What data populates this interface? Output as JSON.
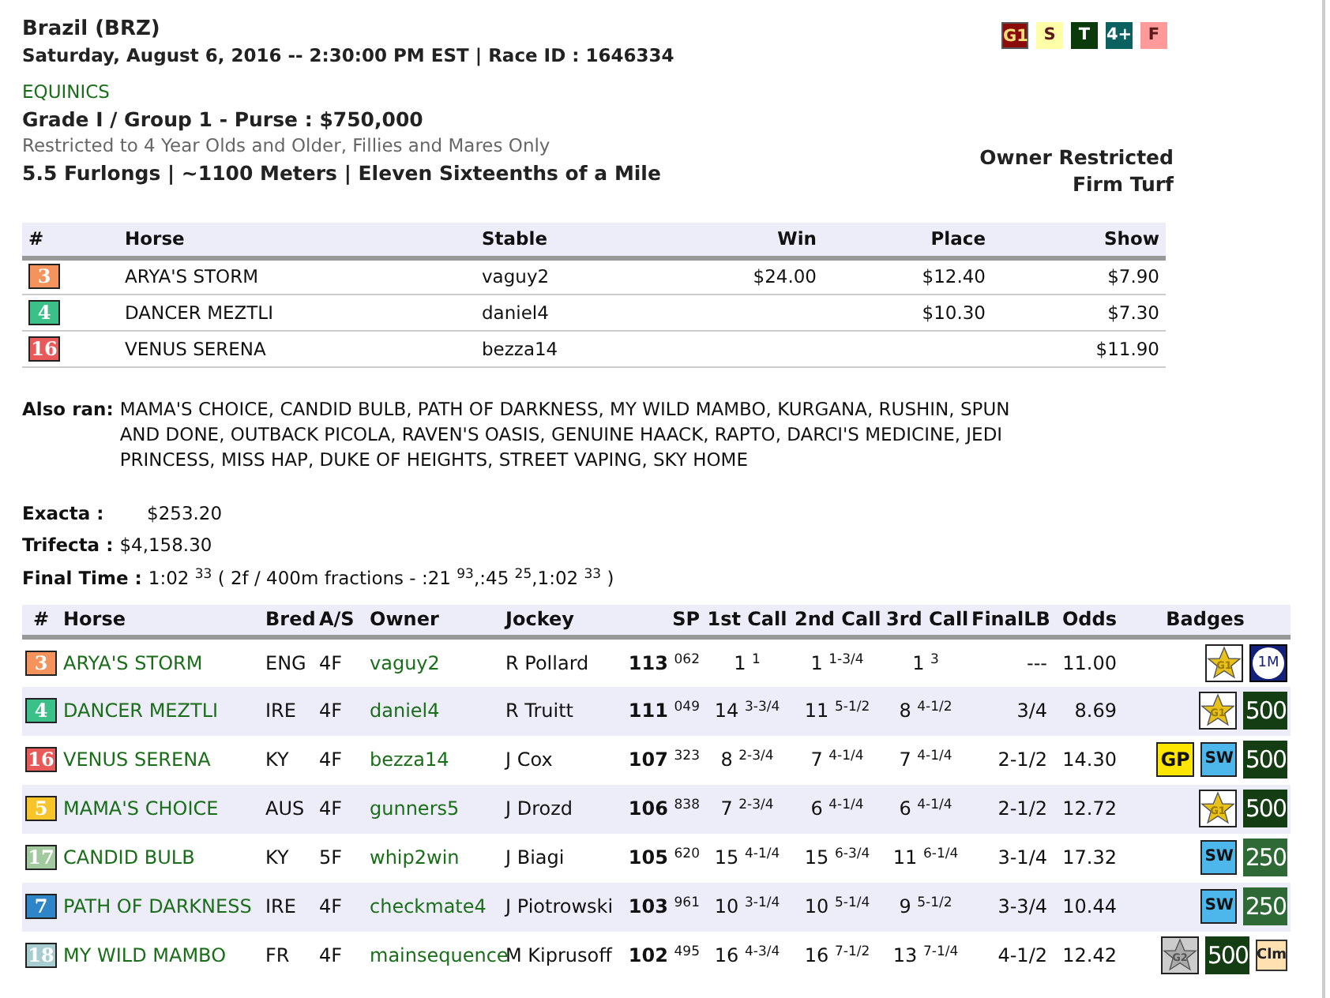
{
  "race": {
    "track": "Brazil (BRZ)",
    "datetime": "Saturday, August 6, 2016 -- 2:30:00 PM EST | Race ID : 1646334",
    "name": "EQUINICS",
    "grade": "Grade I / Group 1 - Purse : $750,000",
    "restriction": "Restricted to 4 Year Olds and Older, Fillies and Mares Only",
    "distance": "5.5 Furlongs | ~1100 Meters | Eleven Sixteenths of a Mile",
    "owner_note": "Owner Restricted",
    "surface": "Firm Turf"
  },
  "race_badges": [
    {
      "label": "G1",
      "color": "#8b0a0a"
    },
    {
      "label": "S",
      "color": "#ffffa8"
    },
    {
      "label": "T",
      "color": "#0b3a0b"
    },
    {
      "label": "4+",
      "color": "#0b6060"
    },
    {
      "label": "F",
      "color": "#ff9a9a"
    }
  ],
  "results": {
    "columns": [
      "#",
      "Horse",
      "Stable",
      "Win",
      "Place",
      "Show"
    ],
    "rows": [
      {
        "post": "3",
        "color": "#f4935c",
        "horse": "ARYA'S STORM",
        "stable": "vaguy2",
        "win": "$24.00",
        "place": "$12.40",
        "show": "$7.90"
      },
      {
        "post": "4",
        "color": "#3cc08a",
        "horse": "DANCER MEZTLI",
        "stable": "daniel4",
        "place": "$10.30",
        "show": "$7.30"
      },
      {
        "post": "16",
        "color": "#e85a5a",
        "horse": "VENUS SERENA",
        "stable": "bezza14",
        "show": "$11.90"
      }
    ]
  },
  "also_ran": {
    "label": "Also ran:",
    "text": "MAMA'S CHOICE, CANDID BULB, PATH OF DARKNESS, MY WILD MAMBO, KURGANA, RUSHIN, SPUN AND DONE, OUTBACK PICOLA, RAVEN'S OASIS, GENUINE HAACK, RAPTO, DARCI'S MEDICINE, JEDI PRINCESS, MISS HAP, DUKE OF HEIGHTS, STREET VAPING, SKY HOME"
  },
  "payouts": [
    {
      "label": "Exacta :",
      "value": "$253.20"
    },
    {
      "label": "Trifecta :",
      "value": "$4,158.30"
    }
  ],
  "final_time": {
    "label": "Final Time :",
    "value": "1:02 $^{33}$  ( 2f / 400m fractions - :21 $^{93}$,:45 $^{25}$,1:02 $^{33}$ )"
  },
  "field": {
    "columns": [
      "#",
      "Horse",
      "Bred",
      "A/S",
      "Owner",
      "Jockey",
      "SP",
      "1st Call",
      "2nd Call",
      "3rd Call",
      "FinalLB",
      "Odds",
      "Badges"
    ],
    "rows": [
      {
        "post": "3",
        "color": "#f4935c",
        "horse": "ARYA'S STORM",
        "bred": "ENG",
        "as": "4F",
        "owner": "vaguy2",
        "jockey": "R Pollard",
        "sp": "**113** $^{062}$",
        "call1": "1 $^{1}$",
        "call2": "1 $^{1-3/4}$",
        "call3": "1 $^{3}$",
        "final_lb": "---",
        "odds": "11.00",
        "badges": [
          {
            "kind": "star",
            "label": "G1"
          },
          {
            "kind": "coin",
            "label": "1M"
          }
        ]
      },
      {
        "post": "4",
        "color": "#3cc08a",
        "horse": "DANCER MEZTLI",
        "bred": "IRE",
        "as": "4F",
        "owner": "daniel4",
        "jockey": "R Truitt",
        "sp": "**111** $^{049}$",
        "call1": "14 $^{3-3/4}$",
        "call2": "11 $^{5-1/2}$",
        "call3": "8 $^{4-1/2}$",
        "final_lb": "3/4",
        "odds": "8.69",
        "badges": [
          {
            "kind": "star",
            "label": "G1"
          },
          {
            "kind": "dark",
            "label": "500"
          }
        ]
      },
      {
        "post": "16",
        "color": "#e85a5a",
        "horse": "VENUS SERENA",
        "bred": "KY",
        "as": "4F",
        "owner": "bezza14",
        "jockey": "J Cox",
        "sp": "**107** $^{323}$",
        "call1": "8 $^{2-3/4}$",
        "call2": "7 $^{4-1/4}$",
        "call3": "7 $^{4-1/4}$",
        "final_lb": "2-1/2",
        "odds": "14.30",
        "badges": [
          {
            "kind": "gp",
            "label": "GP"
          },
          {
            "kind": "sw",
            "label": "SW"
          },
          {
            "kind": "dark",
            "label": "500"
          }
        ]
      },
      {
        "post": "5",
        "color": "#f7c52a",
        "horse": "MAMA'S CHOICE",
        "bred": "AUS",
        "as": "4F",
        "owner": "gunners5",
        "jockey": "J Drozd",
        "sp": "**106** $^{838}$",
        "call1": "7 $^{2-3/4}$",
        "call2": "6 $^{4-1/4}$",
        "call3": "6 $^{4-1/4}$",
        "final_lb": "2-1/2",
        "odds": "12.72",
        "badges": [
          {
            "kind": "star",
            "label": "G1"
          },
          {
            "kind": "dark",
            "label": "500"
          }
        ]
      },
      {
        "post": "17",
        "color": "#a3c99e",
        "horse": "CANDID BULB",
        "bred": "KY",
        "as": "5F",
        "owner": "whip2win",
        "jockey": "J Biagi",
        "sp": "**105** $^{620}$",
        "call1": "15 $^{4-1/4}$",
        "call2": "15 $^{6-3/4}$",
        "call3": "11 $^{6-1/4}$",
        "final_lb": "3-1/4",
        "odds": "17.32",
        "badges": [
          {
            "kind": "sw",
            "label": "SW"
          },
          {
            "kind": "green",
            "label": "250"
          }
        ]
      },
      {
        "post": "7",
        "color": "#2e86c8",
        "horse": "PATH OF DARKNESS",
        "bred": "IRE",
        "as": "4F",
        "owner": "checkmate4",
        "jockey": "J Piotrowski",
        "sp": "**103** $^{961}$",
        "call1": "10 $^{3-1/4}$",
        "call2": "10 $^{5-1/4}$",
        "call3": "9 $^{5-1/2}$",
        "final_lb": "3-3/4",
        "odds": "10.44",
        "badges": [
          {
            "kind": "sw",
            "label": "SW"
          },
          {
            "kind": "green",
            "label": "250"
          }
        ]
      },
      {
        "post": "18",
        "color": "#a8cdd0",
        "horse": "MY WILD MAMBO",
        "bred": "FR",
        "as": "4F",
        "owner": "mainsequence",
        "jockey": "M Kiprusoff",
        "sp": "**102** $^{495}$",
        "call1": "16 $^{4-3/4}$",
        "call2": "16 $^{7-1/2}$",
        "call3": "13 $^{7-1/4}$",
        "final_lb": "4-1/2",
        "odds": "12.42",
        "badges": [
          {
            "kind": "silver-star",
            "label": "G2"
          },
          {
            "kind": "dark",
            "label": "500"
          },
          {
            "kind": "claim",
            "label": "Clm"
          }
        ]
      }
    ]
  }
}
